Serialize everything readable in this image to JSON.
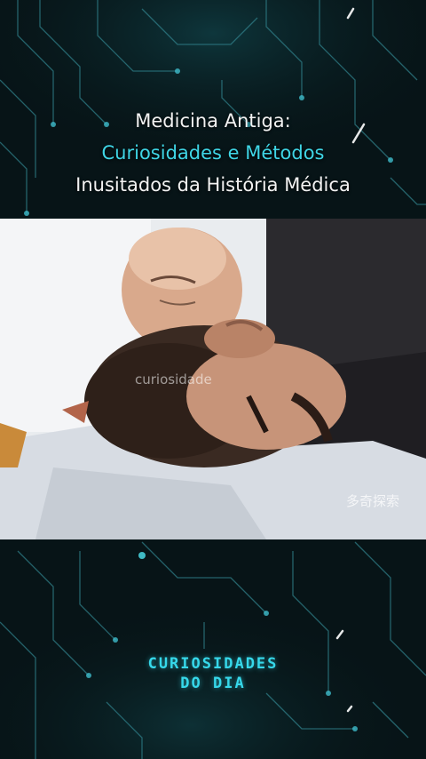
{
  "title": {
    "line1": "Medicina Antiga:",
    "line2": "Curiosidades e Métodos",
    "line3": "Inusitados da História Médica"
  },
  "video": {
    "watermark_center": "curiosidade",
    "watermark_cn": "多奇探索"
  },
  "brand": {
    "line1": "CURIOSIDADES",
    "line2": "DO DIA"
  },
  "colors": {
    "background": "#071417",
    "accent": "#3fd6e6",
    "brand": "#36d8ea"
  }
}
